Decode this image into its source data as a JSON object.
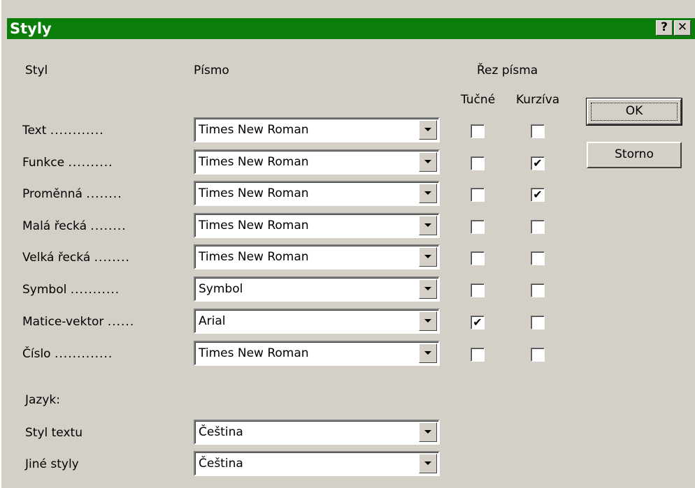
{
  "dialog": {
    "title": "Styly",
    "help_button": "?",
    "close_button": "✕"
  },
  "headers": {
    "style": "Styl",
    "font": "Písmo",
    "font_cut": "Řez písma",
    "bold": "Tučné",
    "italic": "Kurzíva"
  },
  "rows": [
    {
      "label": "Text",
      "dots": "............",
      "font": "Times New Roman",
      "bold": false,
      "italic": false
    },
    {
      "label": "Funkce",
      "dots": "..........",
      "font": "Times New Roman",
      "bold": false,
      "italic": true
    },
    {
      "label": "Proměnná",
      "dots": "........",
      "font": "Times New Roman",
      "bold": false,
      "italic": true
    },
    {
      "label": "Malá řecká",
      "dots": "........",
      "font": "Times New Roman",
      "bold": false,
      "italic": false
    },
    {
      "label": "Velká řecká",
      "dots": "........",
      "font": "Times New Roman",
      "bold": false,
      "italic": false
    },
    {
      "label": "Symbol",
      "dots": "...........",
      "font": "Symbol",
      "bold": false,
      "italic": false
    },
    {
      "label": "Matice-vektor",
      "dots": "......",
      "font": "Arial",
      "bold": true,
      "italic": false
    },
    {
      "label": "Číslo",
      "dots": ".............",
      "font": "Times New Roman",
      "bold": false,
      "italic": false
    }
  ],
  "language": {
    "heading": "Jazyk:",
    "text_style_label": "Styl textu",
    "text_style_value": "Čeština",
    "other_styles_label": "Jiné styly",
    "other_styles_value": "Čeština"
  },
  "buttons": {
    "ok": "OK",
    "cancel": "Storno"
  },
  "colors": {
    "titlebar": "#0a7d0a",
    "dialog_bg": "#d4d0c8"
  }
}
